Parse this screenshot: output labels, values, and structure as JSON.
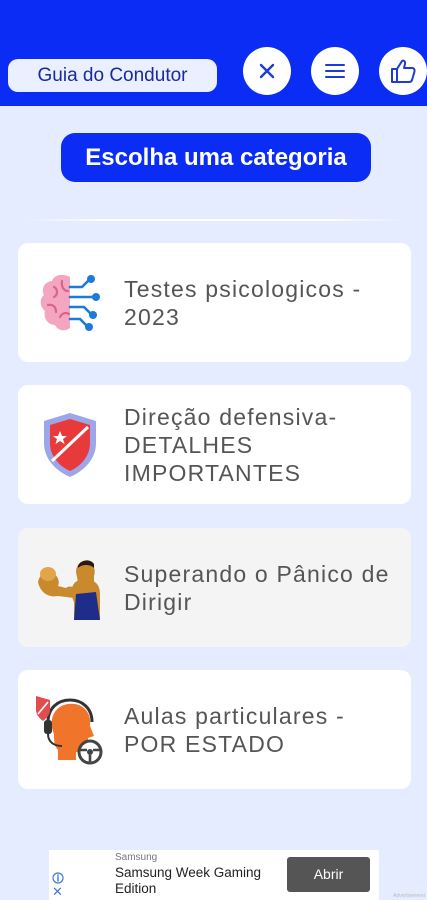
{
  "header": {
    "app_title": "Guia do Condutor",
    "accent_color": "#0a2cf5",
    "buttons": [
      {
        "icon": "close-icon"
      },
      {
        "icon": "menu-icon"
      },
      {
        "icon": "thumbs-up-icon"
      }
    ]
  },
  "main": {
    "title": "Escolha uma categoria",
    "categories": [
      {
        "label": "Testes psicologicos - 2023",
        "icon": "brain-circuit-icon"
      },
      {
        "label": "Direção defensiva- DETALHES IMPORTANTES",
        "icon": "shield-icon"
      },
      {
        "label": "Superando o Pânico de Dirigir",
        "icon": "strong-man-icon"
      },
      {
        "label": "Aulas particulares - POR ESTADO",
        "icon": "instructor-steering-wheel-icon"
      }
    ]
  },
  "ad": {
    "brand": "Samsung",
    "headline": "Samsung Week Gaming Edition",
    "cta": "Abrir",
    "watermark": "Advertisement"
  }
}
